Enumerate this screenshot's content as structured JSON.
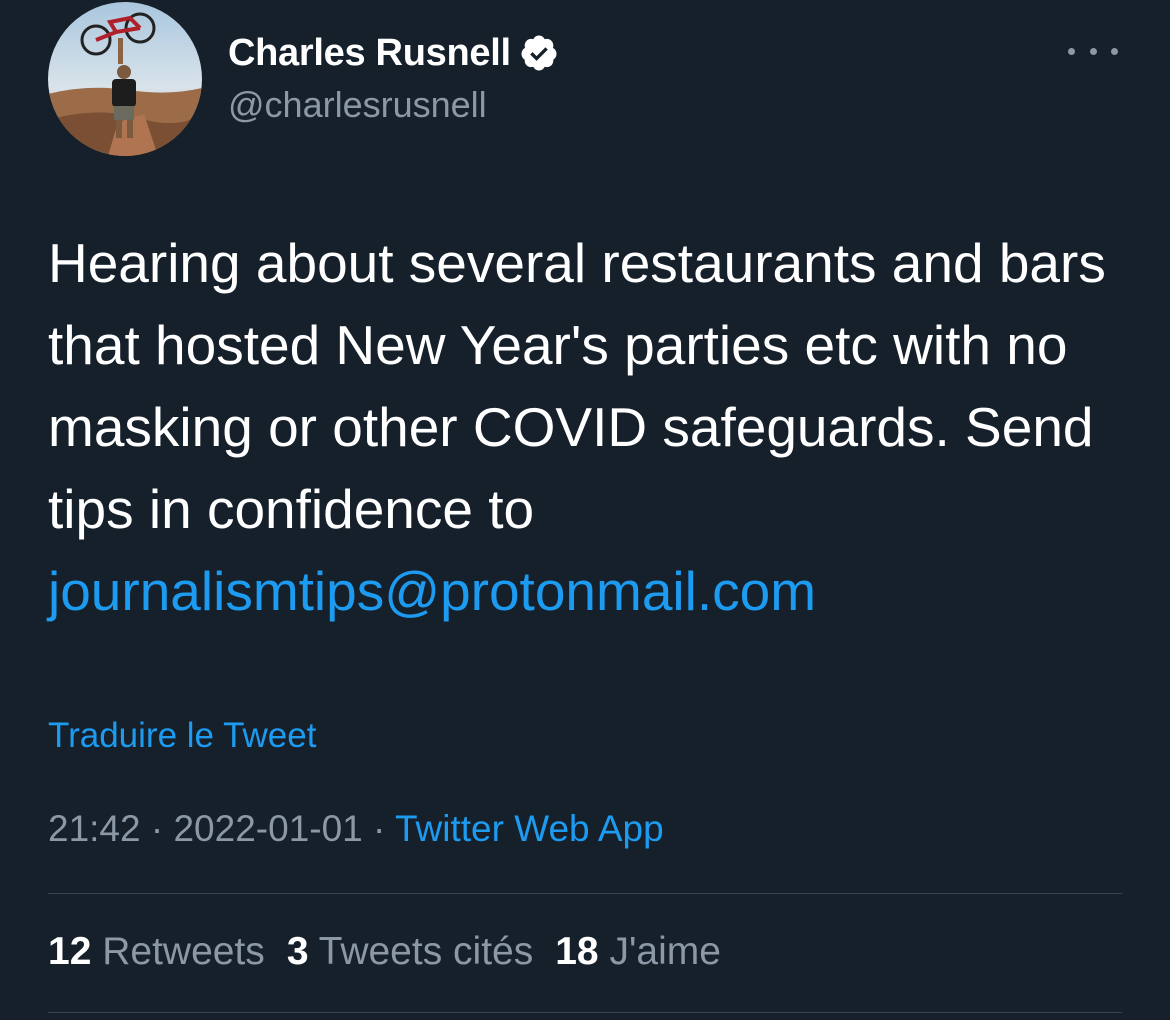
{
  "author": {
    "display_name": "Charles Rusnell",
    "handle": "@charlesrusnell",
    "verified_icon": "verified-badge-icon"
  },
  "tweet": {
    "text_plain": "Hearing about several restaurants and bars that hosted New Year's parties etc with no masking or other COVID safeguards. Send tips in confidence to ",
    "link_text": "journalismtips@protonmail.com",
    "translate_label": "Traduire le Tweet",
    "time": "21:42",
    "date": "2022-01-01",
    "separator": "·",
    "source": "Twitter Web App"
  },
  "stats": {
    "retweets_count": "12",
    "retweets_label": "Retweets",
    "quotes_count": "3",
    "quotes_label": "Tweets cités",
    "likes_count": "18",
    "likes_label": "J'aime"
  },
  "colors": {
    "background": "#15202b",
    "text": "#ffffff",
    "muted": "#8b98a5",
    "accent": "#1d9bf0",
    "divider": "#38444d"
  },
  "icons": {
    "more": "more-horizontal-icon"
  }
}
